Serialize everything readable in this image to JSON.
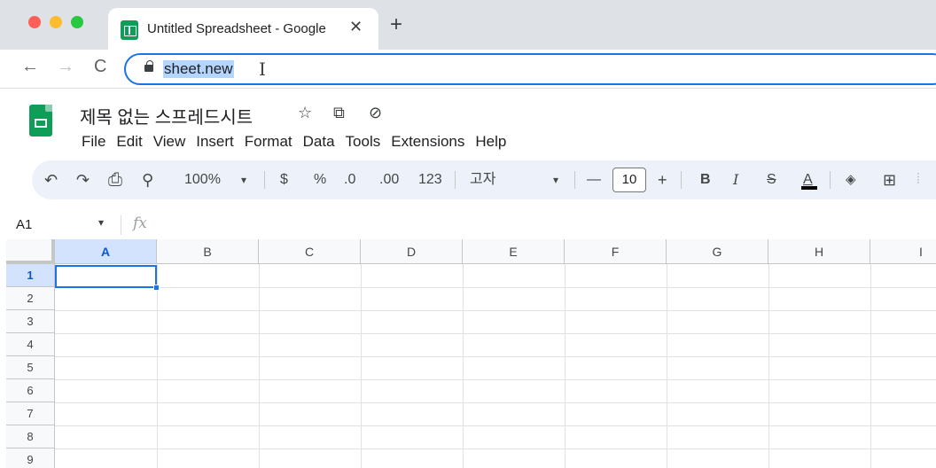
{
  "browser": {
    "tab_title": "Untitled Spreadsheet - Google",
    "tab_close": "✕",
    "new_tab": "+",
    "back": "←",
    "forward": "→",
    "reload": "C",
    "url": "sheet.new",
    "text_cursor": "I"
  },
  "sheet": {
    "title": "제목 없는 스프레드시트",
    "title_icons": {
      "star": "☆",
      "move": "⧉",
      "cloud": "⊘"
    },
    "menu": [
      "File",
      "Edit",
      "View",
      "Insert",
      "Format",
      "Data",
      "Tools",
      "Extensions",
      "Help"
    ]
  },
  "toolbar": {
    "undo": "↶",
    "redo": "↷",
    "print": "⎙",
    "paint_format": "⚲",
    "zoom": "100%",
    "zoom_caret": "▾",
    "currency": "$",
    "percent": "%",
    "decrease_decimal": ".0",
    "increase_decimal": ".00",
    "number_format": "123",
    "font": "고자",
    "font_caret": "▾",
    "minus": "—",
    "font_size": "10",
    "plus": "+",
    "bold": "B",
    "italic": "I",
    "strikethrough": "S",
    "text_color": "A",
    "fill_color": "◈",
    "borders": "⊞",
    "merge": "⦙"
  },
  "formula_bar": {
    "name_box": "A1",
    "caret": "▾",
    "fx": "fx"
  },
  "grid": {
    "columns": [
      "A",
      "B",
      "C",
      "D",
      "E",
      "F",
      "G",
      "H",
      "I"
    ],
    "rows": [
      "1",
      "2",
      "3",
      "4",
      "5",
      "6",
      "7",
      "8",
      "9"
    ],
    "active_cell": "A1"
  },
  "colors": {
    "accent": "#1a73e8",
    "sheets_green": "#0f9d58",
    "toolbar_bg": "#edf2fa",
    "header_active": "#d3e3fd"
  }
}
